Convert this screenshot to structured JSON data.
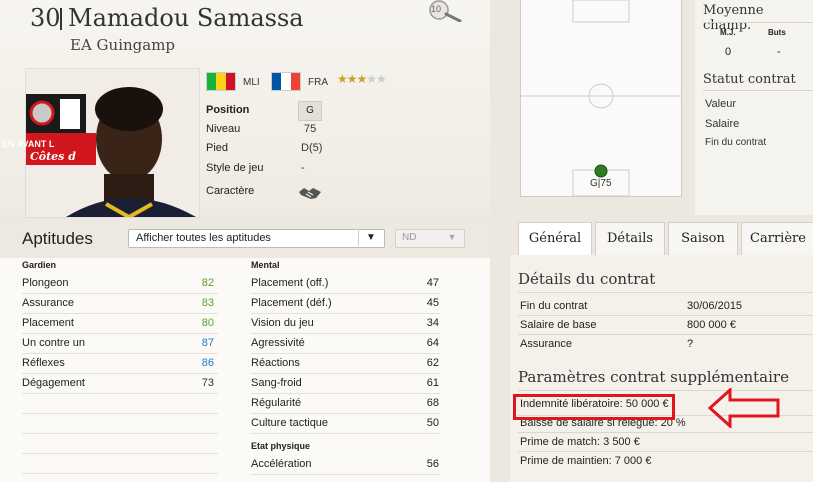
{
  "header": {
    "number": "30",
    "name": "Mamadou Samassa",
    "club": "EA Guingamp",
    "search_badge": "10"
  },
  "nationalities": [
    {
      "code": "MLI",
      "colors": [
        "#14b53a",
        "#fcd116",
        "#ce1126"
      ]
    },
    {
      "code": "FRA",
      "colors": [
        "#0055a4",
        "#ffffff",
        "#ef4135"
      ]
    }
  ],
  "stars": {
    "filled": 3,
    "total": 5,
    "display": "★★★☆☆"
  },
  "attributes": [
    {
      "label": "Position",
      "value": "G"
    },
    {
      "label": "Niveau",
      "value": "75"
    },
    {
      "label": "Pied",
      "value": "D(5)"
    },
    {
      "label": "Style de jeu",
      "value": "-"
    },
    {
      "label": "Caractère",
      "value": "handshake-icon"
    }
  ],
  "aptitudes": {
    "title": "Aptitudes",
    "filter": "Afficher toutes les aptitudes",
    "nd": "ND",
    "left": {
      "section": "Gardien",
      "rows": [
        {
          "label": "Plongeon",
          "value": "82",
          "color": "#5aa52a"
        },
        {
          "label": "Assurance",
          "value": "83",
          "color": "#5aa52a"
        },
        {
          "label": "Placement",
          "value": "80",
          "color": "#5aa52a"
        },
        {
          "label": "Un contre un",
          "value": "87",
          "color": "#2a79c2"
        },
        {
          "label": "Réflexes",
          "value": "86",
          "color": "#2a79c2"
        },
        {
          "label": "Dégagement",
          "value": "73",
          "color": "#333333"
        }
      ]
    },
    "right": {
      "section": "Mental",
      "rows": [
        {
          "label": "Placement (off.)",
          "value": "47"
        },
        {
          "label": "Placement (déf.)",
          "value": "45"
        },
        {
          "label": "Vision du jeu",
          "value": "34"
        },
        {
          "label": "Agressivité",
          "value": "64"
        },
        {
          "label": "Réactions",
          "value": "62"
        },
        {
          "label": "Sang-froid",
          "value": "61"
        },
        {
          "label": "Régularité",
          "value": "68"
        },
        {
          "label": "Culture tactique",
          "value": "50"
        }
      ],
      "section2": "Etat physique",
      "rows2": [
        {
          "label": "Accélération",
          "value": "56"
        }
      ]
    }
  },
  "pitch": {
    "marker_label": "G|75"
  },
  "right_info": {
    "moyenne": "Moyenne champ.",
    "mj_header": "M.J.",
    "buts_header": "Buts",
    "mj_value": "0",
    "buts_value": "-",
    "statut": "Statut contrat",
    "valeur": "Valeur",
    "salaire": "Salaire",
    "fin_contrat": "Fin du contrat"
  },
  "tabs": [
    "Général",
    "Détails",
    "Saison",
    "Carrière"
  ],
  "contract": {
    "title": "Détails du contrat",
    "rows": [
      {
        "label": "Fin du contrat",
        "value": "30/06/2015"
      },
      {
        "label": "Salaire de base",
        "value": "800 000 €"
      },
      {
        "label": "Assurance",
        "value": "?"
      }
    ],
    "extra_title": "Paramètres contrat supplémentaire",
    "extras": [
      "Indemnité libératoire: 50 000 €",
      "Baisse de salaire si relégué: 20 %",
      "Prime de match: 3 500 €",
      "Prime de maintien: 7 000 €"
    ]
  },
  "photo_banner": {
    "line1": "EN AVANT L",
    "line2": "Côtes d"
  },
  "highlight_color": "#e0161f"
}
